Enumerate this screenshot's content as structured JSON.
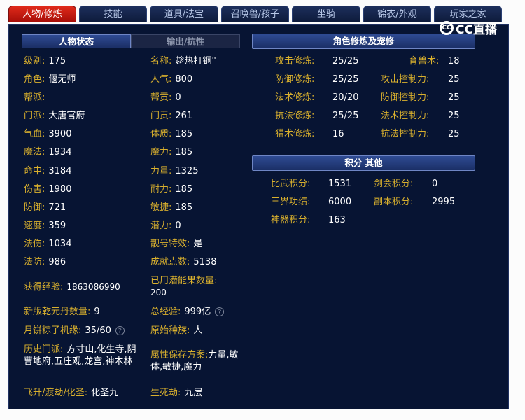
{
  "tabs": [
    "人物/修炼",
    "技能",
    "道具/法宝",
    "召唤兽/孩子",
    "坐骑",
    "锦衣/外观",
    "玩家之家"
  ],
  "logo": {
    "text": "CC直播",
    "mark": "CC"
  },
  "inner_tabs": [
    "人物状态",
    "输出/抗性"
  ],
  "section_headers": {
    "cultivation": "角色修炼及宠修",
    "score": "积分 其他"
  },
  "status_left": [
    {
      "label": "级别:",
      "value": "175"
    },
    {
      "label": "角色:",
      "value": "偃无师"
    },
    {
      "label": "帮派:",
      "value": ""
    },
    {
      "label": "门派:",
      "value": "大唐官府"
    },
    {
      "label": "气血:",
      "value": "3900"
    },
    {
      "label": "魔法:",
      "value": "1934"
    },
    {
      "label": "命中:",
      "value": "3184"
    },
    {
      "label": "伤害:",
      "value": "1980"
    },
    {
      "label": "防御:",
      "value": "721"
    },
    {
      "label": "速度:",
      "value": "359"
    },
    {
      "label": "法伤:",
      "value": "1034"
    },
    {
      "label": "法防:",
      "value": "986"
    }
  ],
  "status_right": [
    {
      "label": "名称:",
      "value": "趁热打铜°"
    },
    {
      "label": "人气:",
      "value": "800"
    },
    {
      "label": "帮贡:",
      "value": "0"
    },
    {
      "label": "门贡:",
      "value": "261"
    },
    {
      "label": "体质:",
      "value": "185"
    },
    {
      "label": "魔力:",
      "value": "185"
    },
    {
      "label": "力量:",
      "value": "1325"
    },
    {
      "label": "耐力:",
      "value": "185"
    },
    {
      "label": "敏捷:",
      "value": "185"
    },
    {
      "label": "潜力:",
      "value": "0"
    },
    {
      "label": "靓号特效:",
      "value": "是"
    },
    {
      "label": "成就点数:",
      "value": "5138"
    }
  ],
  "extra": {
    "exp": {
      "label": "获得经验:",
      "value": "1863086990"
    },
    "used_fruit": {
      "label": "已用潜能果数量:",
      "value": "200"
    },
    "qianyuan": {
      "label": "新版乾元丹数量:",
      "value": "9"
    },
    "total_exp": {
      "label": "总经验:",
      "value": "999亿"
    },
    "mooncake": {
      "label": "月饼粽子机缘:",
      "value": "35/60"
    },
    "race": {
      "label": "原始种族:",
      "value": "人"
    },
    "history": {
      "label": "历史门派:",
      "value": "方寸山,化生寺,阴曹地府,五庄观,龙宫,神木林"
    },
    "save_plan": {
      "label": "属性保存方案:",
      "value": "力量,敏体,敏捷,魔力"
    },
    "ascend": {
      "label": "飞升/渡劫/化圣:",
      "value": "化圣九"
    },
    "life_death": {
      "label": "生死劫:",
      "value": "九层"
    }
  },
  "cultivation": [
    {
      "label": "攻击修炼:",
      "value": "25/25",
      "label2": "育兽术:",
      "value2": "18"
    },
    {
      "label": "防御修炼:",
      "value": "25/25",
      "label2": "攻击控制力:",
      "value2": "25"
    },
    {
      "label": "法术修炼:",
      "value": "20/20",
      "label2": "防御控制力:",
      "value2": "25"
    },
    {
      "label": "抗法修炼:",
      "value": "25/25",
      "label2": "法术控制力:",
      "value2": "25"
    },
    {
      "label": "猎术修炼:",
      "value": "16",
      "label2": "抗法控制力:",
      "value2": "25"
    }
  ],
  "scores": [
    {
      "label": "比武积分:",
      "value": "1531",
      "label2": "剑会积分:",
      "value2": "0"
    },
    {
      "label": "三界功绩:",
      "value": "6000",
      "label2": "副本积分:",
      "value2": "2995"
    },
    {
      "label": "神器积分:",
      "value": "163"
    }
  ]
}
